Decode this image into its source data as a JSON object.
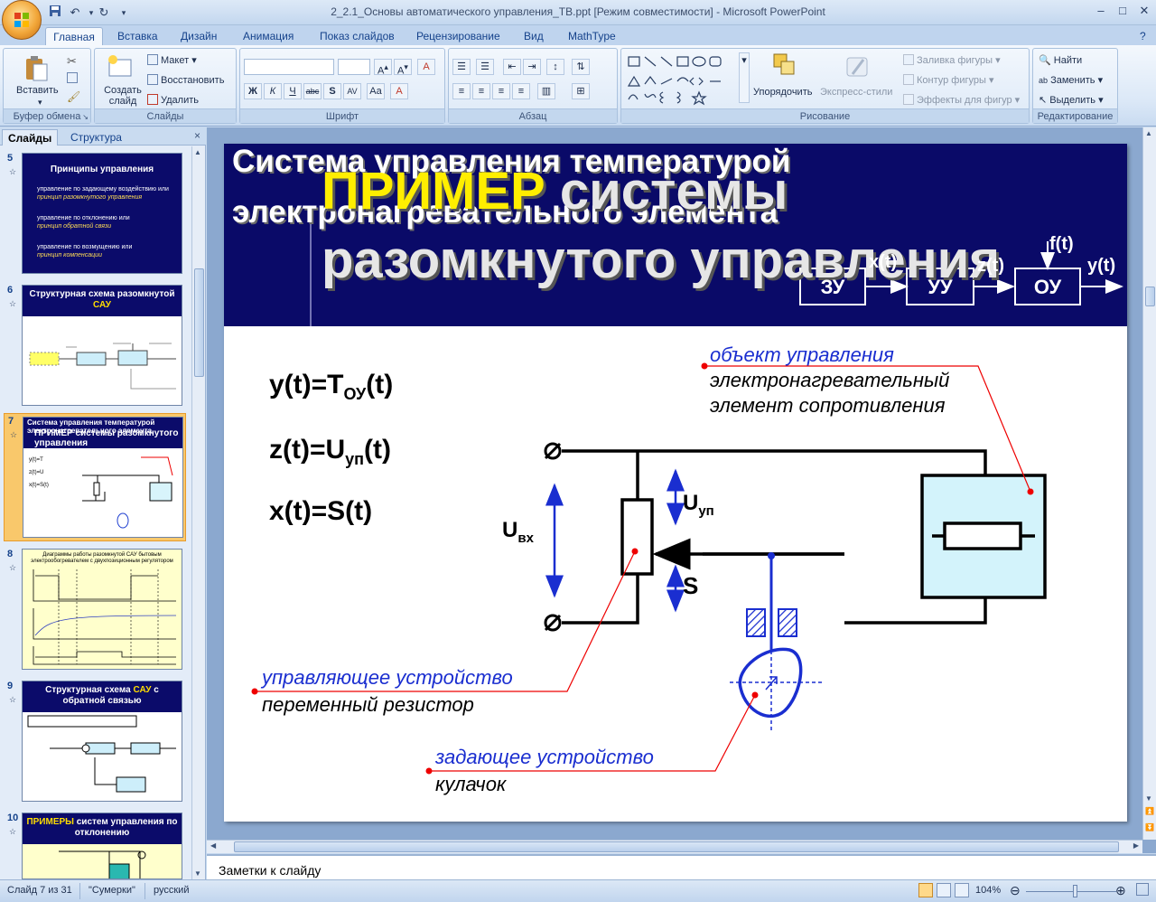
{
  "window": {
    "title": "2_2.1_Основы автоматического управления_ТВ.ppt [Режим совместимости] - Microsoft PowerPoint"
  },
  "tabs": [
    "Главная",
    "Вставка",
    "Дизайн",
    "Анимация",
    "Показ слайдов",
    "Рецензирование",
    "Вид",
    "MathType"
  ],
  "ribbon": {
    "clipboard": {
      "label": "Буфер обмена",
      "paste": "Вставить"
    },
    "slides": {
      "label": "Слайды",
      "new_slide": "Создать слайд",
      "layout": "Макет",
      "reset": "Восстановить",
      "delete": "Удалить"
    },
    "font": {
      "label": "Шрифт"
    },
    "paragraph": {
      "label": "Абзац"
    },
    "drawing": {
      "label": "Рисование",
      "arrange": "Упорядочить",
      "quick_styles": "Экспресс-стили",
      "fill": "Заливка фигуры",
      "outline": "Контур фигуры",
      "effects": "Эффекты для фигур"
    },
    "editing": {
      "label": "Редактирование",
      "find": "Найти",
      "replace": "Заменить",
      "select": "Выделить"
    }
  },
  "left_pane": {
    "tab_slides": "Слайды",
    "tab_outline": "Структура",
    "slides": [
      {
        "num": "5",
        "title": "Принципы управления",
        "lines": [
          "управление по задающему воздействию или",
          "принцип разомкнутого управления",
          "управление по отклонению или",
          "принцип обратной связи",
          "управление по возмущению или",
          "принцип компенсации"
        ]
      },
      {
        "num": "6",
        "title": "Структурная схема разомкнутой",
        "title_accent": "САУ"
      },
      {
        "num": "7",
        "title": "Система управления температурой электронагревательного элемента",
        "subtitle": "ПРИМЕР системы разомкнутого управления"
      },
      {
        "num": "8",
        "title": "Диаграммы работы разомкнутой САУ бытовым электрообогревателем с двухпозиционным регулятором"
      },
      {
        "num": "9",
        "title": "Структурная схема",
        "title_accent": "САУ",
        "title_end": "с обратной связью"
      },
      {
        "num": "10",
        "title_accent": "ПРИМЕРЫ",
        "title": "систем управления по отклонению"
      }
    ]
  },
  "slide": {
    "title_line1": "Система управления температурой",
    "title_line2": "электронагревательного элемента",
    "overlay_accent": "ПРИМЕР",
    "overlay_rest": "системы",
    "overlay_line2": "разомкнутого управления",
    "blocks": [
      "ЗУ",
      "УУ",
      "ОУ"
    ],
    "signals": {
      "x": "x(t)",
      "z": "z(t)",
      "f": "f(t)",
      "y": "y(t)"
    },
    "eq1": {
      "lhs": "y(t)=T",
      "sub": "ОУ",
      "rhs": "(t)"
    },
    "eq2": {
      "lhs": "z(t)=U",
      "sub": "уп",
      "rhs": "(t)"
    },
    "eq3": "x(t)=S(t)",
    "labels": {
      "uin": "U",
      "uin_sub": "вх",
      "uup": "U",
      "uup_sub": "уп",
      "s": "S",
      "obj_title": "объект управления",
      "obj_l1": "электронагревательный",
      "obj_l2": "элемент сопротивления",
      "ctl_title": "управляющее устройство",
      "ctl_l1": "переменный резистор",
      "set_title": "задающее устройство",
      "set_l1": "кулачок"
    }
  },
  "notes_placeholder": "Заметки к слайду",
  "status": {
    "slide": "Слайд 7 из 31",
    "theme": "\"Сумерки\"",
    "lang": "русский",
    "zoom": "104%"
  }
}
